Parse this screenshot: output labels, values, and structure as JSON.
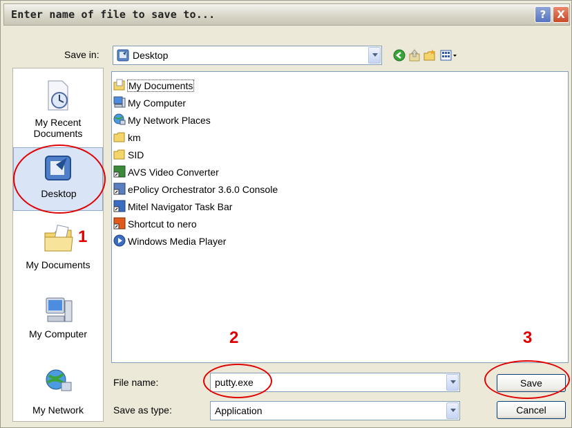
{
  "window": {
    "title": "Enter name of file to save to...",
    "help_label": "?",
    "close_label": "X"
  },
  "toolbar": {
    "save_in_label": "Save in:",
    "save_in_value": "Desktop",
    "icons": [
      "back-icon",
      "up-folder-icon",
      "new-folder-icon",
      "views-menu-icon"
    ]
  },
  "places": [
    {
      "label": "My Recent Documents",
      "icon": "recent-documents-icon"
    },
    {
      "label": "Desktop",
      "icon": "desktop-icon"
    },
    {
      "label": "My Documents",
      "icon": "my-documents-icon"
    },
    {
      "label": "My Computer",
      "icon": "my-computer-icon"
    },
    {
      "label": "My Network",
      "icon": "network-icon"
    }
  ],
  "files": [
    {
      "name": "My Documents",
      "icon": "folder-documents-icon",
      "selected": true
    },
    {
      "name": "My Computer",
      "icon": "computer-icon"
    },
    {
      "name": "My Network Places",
      "icon": "network-places-icon"
    },
    {
      "name": "km",
      "icon": "folder-icon"
    },
    {
      "name": "SID",
      "icon": "folder-icon"
    },
    {
      "name": "AVS Video Converter",
      "icon": "shortcut-icon"
    },
    {
      "name": "ePolicy Orchestrator 3.6.0 Console",
      "icon": "shortcut-icon"
    },
    {
      "name": "Mitel Navigator Task Bar",
      "icon": "shortcut-icon"
    },
    {
      "name": "Shortcut to nero",
      "icon": "shortcut-icon"
    },
    {
      "name": "Windows Media Player",
      "icon": "media-player-icon"
    }
  ],
  "form": {
    "file_name_label": "File name:",
    "file_name_value": "putty.exe",
    "save_as_type_label": "Save as type:",
    "save_as_type_value": "Application"
  },
  "buttons": {
    "save": "Save",
    "cancel": "Cancel"
  },
  "annotations": {
    "step1": "1",
    "step2": "2",
    "step3": "3",
    "color": "#e00000"
  }
}
